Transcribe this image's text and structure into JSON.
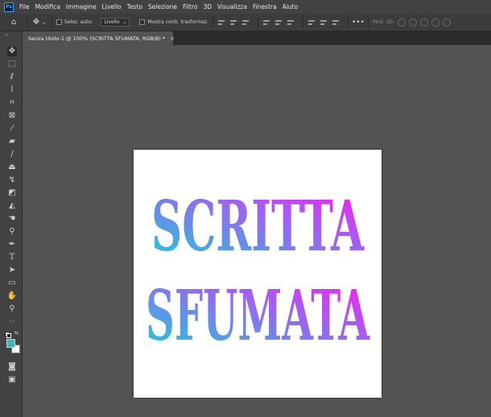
{
  "app": {
    "logo": "Ps",
    "menu": [
      "File",
      "Modifica",
      "Immagine",
      "Livello",
      "Testo",
      "Selezione",
      "Filtro",
      "3D",
      "Visualizza",
      "Finestra",
      "Aiuto"
    ]
  },
  "options_bar": {
    "auto_select_label": "Selez. auto:",
    "auto_select_value": "Livello",
    "show_transform_label": "Mostra contr. trasformaz.",
    "mode_3d_label": "Mod. 3D:"
  },
  "tools": [
    {
      "name": "move-tool",
      "icon": "move-icon",
      "glyph": "✥"
    },
    {
      "name": "marquee-tool",
      "icon": "rect-marquee-icon",
      "glyph": "⬚"
    },
    {
      "name": "lasso-tool",
      "icon": "lasso-icon",
      "glyph": "ℓ"
    },
    {
      "name": "quick-select-tool",
      "icon": "quick-select-icon",
      "glyph": "⌇"
    },
    {
      "name": "crop-tool",
      "icon": "crop-icon",
      "glyph": "⌗"
    },
    {
      "name": "frame-tool",
      "icon": "frame-icon",
      "glyph": "⊠"
    },
    {
      "name": "eyedropper-tool",
      "icon": "eyedropper-icon",
      "glyph": "⁄"
    },
    {
      "name": "healing-brush-tool",
      "icon": "bandage-icon",
      "glyph": "▰"
    },
    {
      "name": "brush-tool",
      "icon": "brush-icon",
      "glyph": "∕"
    },
    {
      "name": "clone-stamp-tool",
      "icon": "stamp-icon",
      "glyph": "⏏"
    },
    {
      "name": "history-brush-tool",
      "icon": "history-brush-icon",
      "glyph": "↯"
    },
    {
      "name": "eraser-tool",
      "icon": "eraser-icon",
      "glyph": "◩"
    },
    {
      "name": "paint-bucket-tool",
      "icon": "bucket-icon",
      "glyph": "◭"
    },
    {
      "name": "smudge-tool",
      "icon": "smudge-icon",
      "glyph": "☚"
    },
    {
      "name": "dodge-tool",
      "icon": "dodge-icon",
      "glyph": "⚲"
    },
    {
      "name": "pen-tool",
      "icon": "pen-icon",
      "glyph": "✒"
    },
    {
      "name": "type-tool",
      "icon": "type-icon",
      "glyph": "T"
    },
    {
      "name": "path-select-tool",
      "icon": "arrow-icon",
      "glyph": "➤"
    },
    {
      "name": "shape-tool",
      "icon": "rectangle-icon",
      "glyph": "▭"
    },
    {
      "name": "hand-tool",
      "icon": "hand-icon",
      "glyph": "✋"
    },
    {
      "name": "zoom-tool",
      "icon": "zoom-icon",
      "glyph": "⚲"
    },
    {
      "name": "more-tools",
      "icon": "ellipsis-icon",
      "glyph": "···"
    }
  ],
  "colors": {
    "foreground": "#34bcbc",
    "background": "#ffffff"
  },
  "document": {
    "tab_title": "Senza titolo-1 @ 100% (SCRITTA SFUMATA, RGB/8) *",
    "close_glyph": "×"
  },
  "canvas": {
    "line1": "SCRITTA",
    "line2": "SFUMATA",
    "gradient": [
      "#17d4d4",
      "#6f86ec",
      "#b94ef4",
      "#ff18f4"
    ]
  }
}
